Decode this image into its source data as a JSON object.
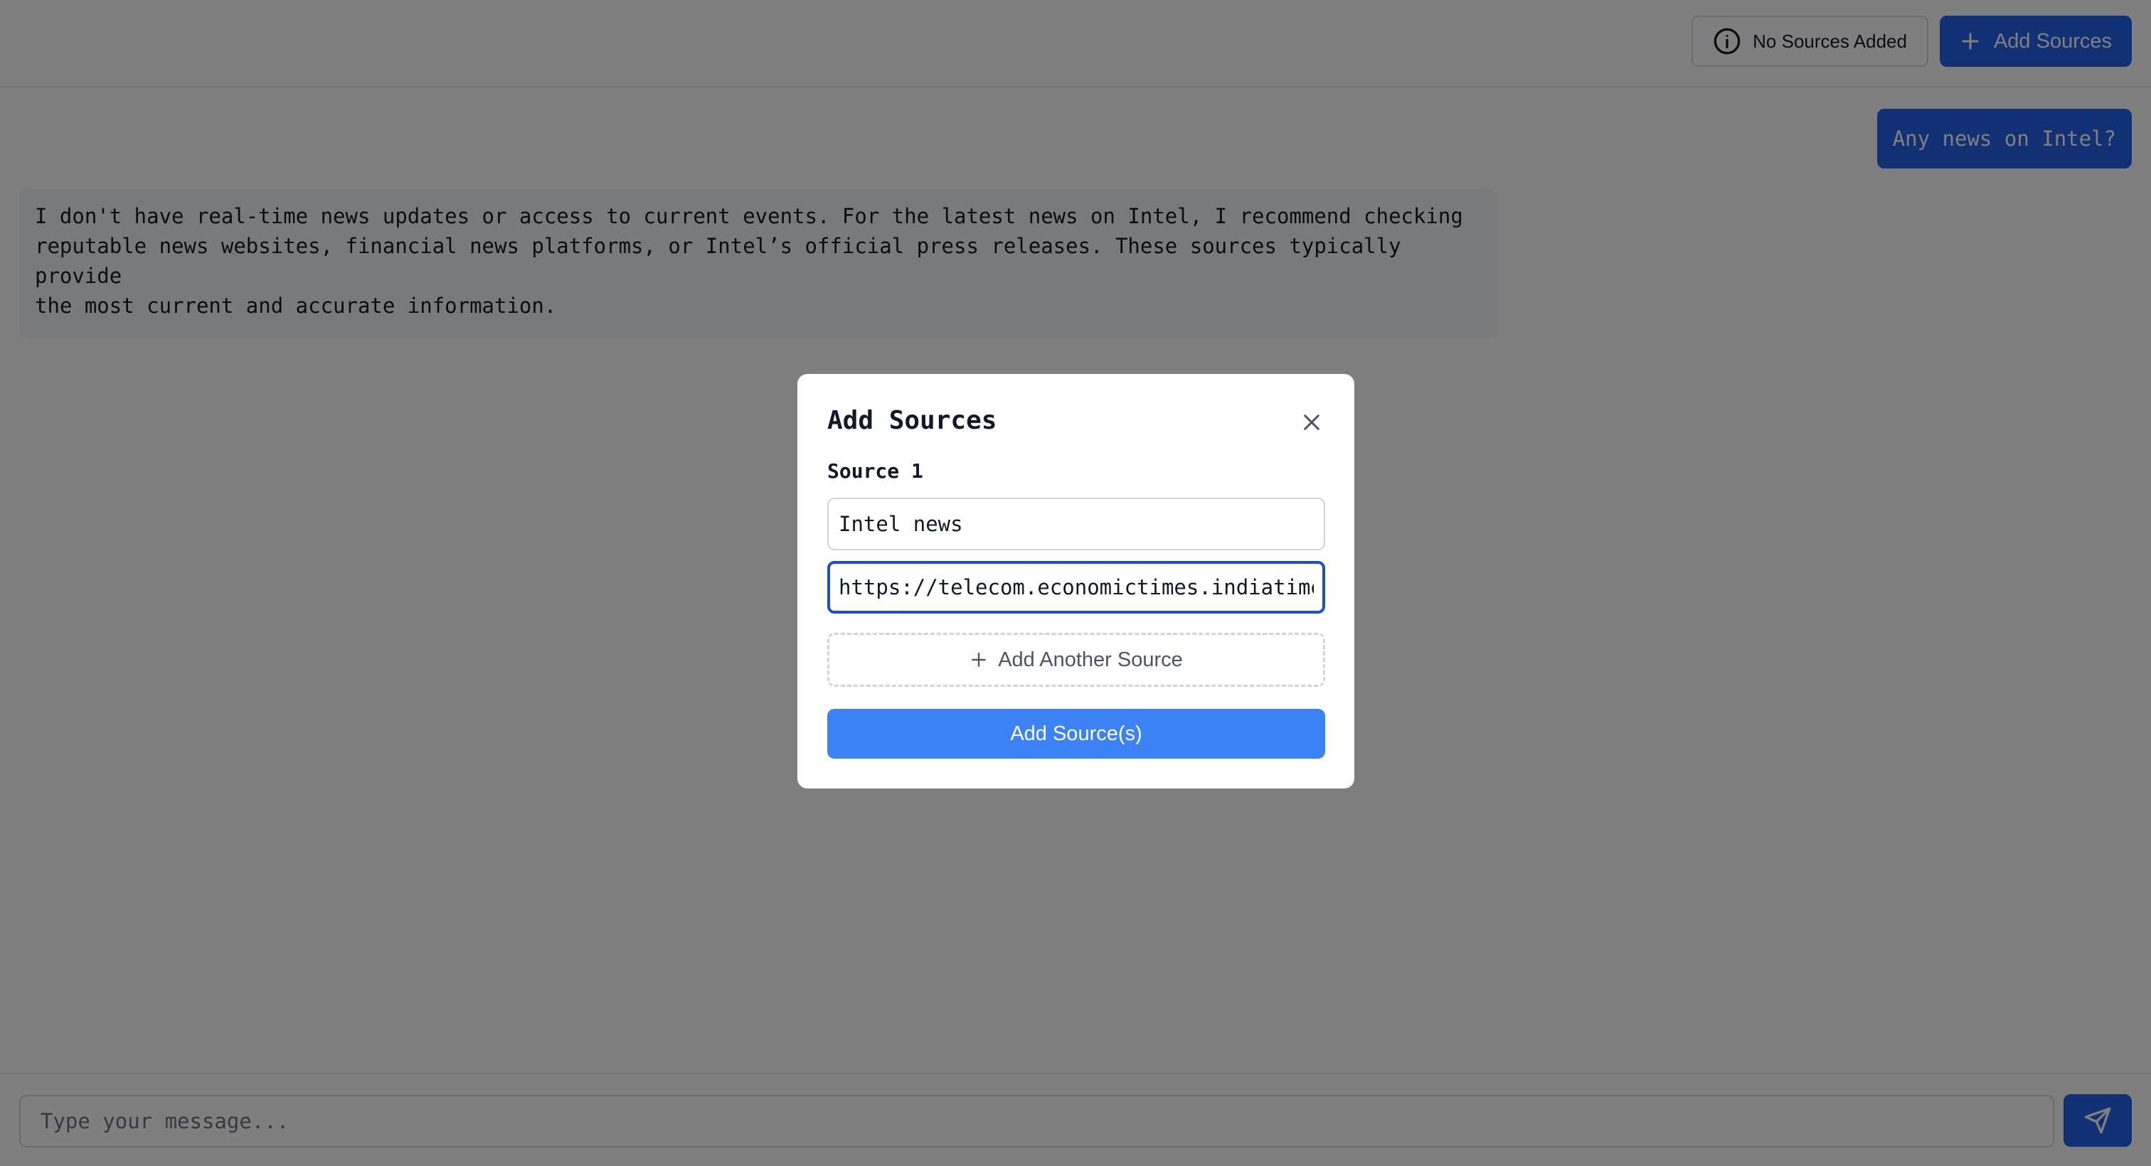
{
  "header": {
    "sources_status": "No Sources Added",
    "sources_status_icon": "info-icon",
    "add_sources_label": "Add Sources",
    "add_sources_icon": "plus-icon"
  },
  "chat": {
    "messages": [
      {
        "role": "user",
        "text": "Any news on Intel?"
      },
      {
        "role": "assistant",
        "text": "I don't have real-time news updates or access to current events. For the latest news on Intel, I recommend checking\nreputable news websites, financial news platforms, or Intel’s official press releases. These sources typically provide\nthe most current and accurate information."
      }
    ]
  },
  "composer": {
    "placeholder": "Type your message...",
    "value": "",
    "send_icon": "send-icon"
  },
  "modal": {
    "title": "Add Sources",
    "close_icon": "close-icon",
    "sources": [
      {
        "label": "Source 1",
        "name_value": "Intel news",
        "url_value": "https://telecom.economictimes.indiatimes"
      }
    ],
    "add_another_label": "Add Another Source",
    "add_another_icon": "plus-icon",
    "submit_label": "Add Source(s)"
  },
  "colors": {
    "primary": "#2563eb",
    "primary_light": "#3b82f6",
    "focus_ring": "#1d4ed8",
    "assistant_bg": "#f3f4f6",
    "overlay": "rgba(0,0,0,0.5)"
  }
}
